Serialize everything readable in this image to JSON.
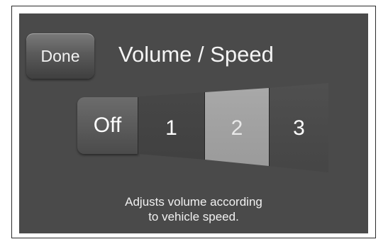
{
  "header": {
    "done_label": "Done",
    "title": "Volume / Speed"
  },
  "selector": {
    "options": [
      "Off",
      "1",
      "2",
      "3"
    ],
    "selected": "2"
  },
  "description": {
    "line1": "Adjusts volume according",
    "line2": "to vehicle speed."
  },
  "colors": {
    "screen_background": "#4a4a4a",
    "selected_segment": "#a6a6a6",
    "text": "#f4f4f4"
  }
}
